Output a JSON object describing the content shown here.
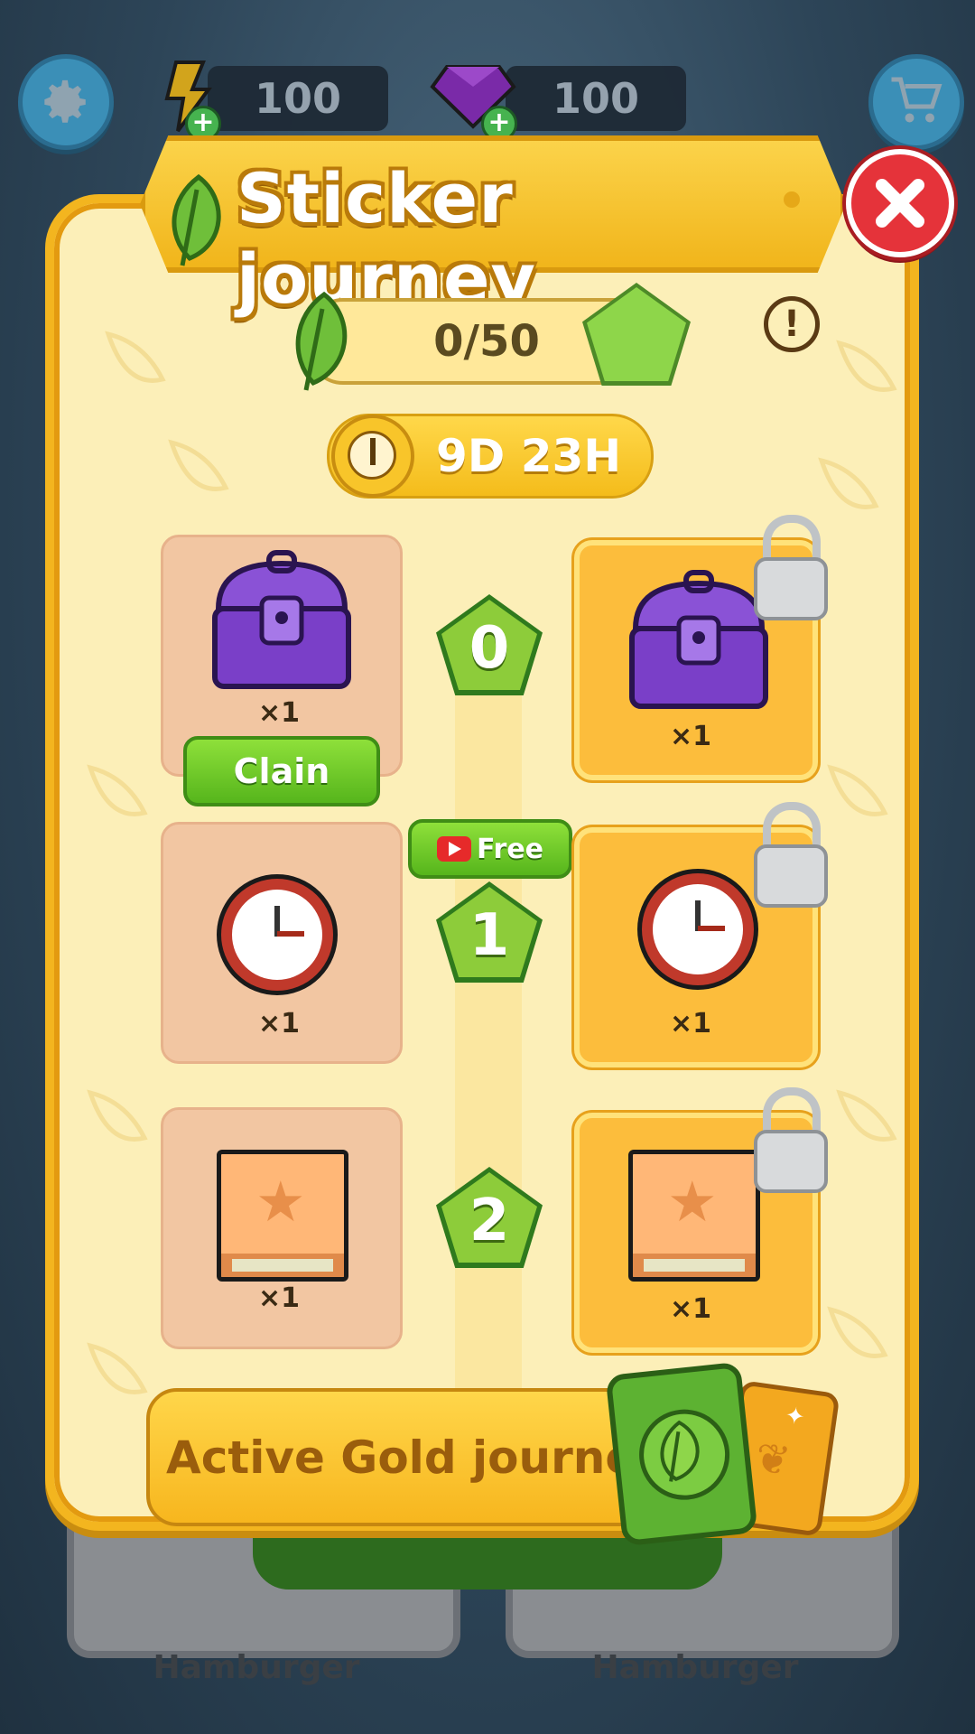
{
  "hud": {
    "energy_value": "100",
    "gems_value": "100",
    "settings_icon": "gear-icon",
    "shop_icon": "cart-icon"
  },
  "background": {
    "card_left_label": "Hamburger",
    "card_right_label": "Hamburger"
  },
  "popup": {
    "title": "Sticker journey",
    "close_icon": "close-icon",
    "progress_text": "0/50",
    "info_icon": "info-icon",
    "timer_text": "9D 23H",
    "tiers": [
      {
        "level": "0",
        "free_reward": "chest",
        "free_qty": "×1",
        "gold_reward": "chest",
        "gold_qty": "×1",
        "claim_label": "Clain"
      },
      {
        "level": "1",
        "free_reward": "clock",
        "free_qty": "×1",
        "gold_reward": "clock",
        "gold_qty": "×1",
        "free_ad_label": "Free"
      },
      {
        "level": "2",
        "free_reward": "sticker-book",
        "free_qty": "×1",
        "gold_reward": "sticker-book",
        "gold_qty": "×1"
      }
    ],
    "gold_banner_text": "Active Gold journey!"
  },
  "colors": {
    "panel_border": "#f3b51f",
    "panel_bg": "#fcefb8",
    "close_red": "#e5333a",
    "claim_green": "#6cc62a",
    "gold_slot": "#fcbd3c",
    "free_slot": "#f2c6a2"
  }
}
